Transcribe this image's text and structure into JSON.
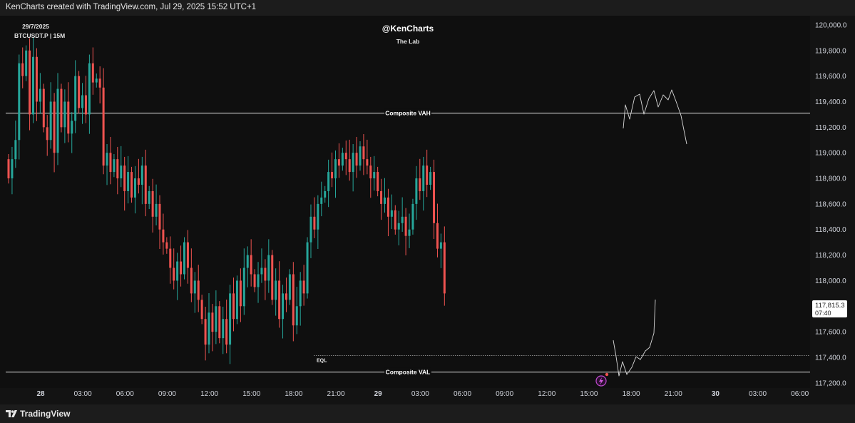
{
  "header": {
    "title": "KenCharts created with TradingView.com, Jul 29, 2025 15:52 UTC+1"
  },
  "footer": {
    "brand": "TradingView"
  },
  "chart_data": {
    "type": "candlestick",
    "symbol_date": "29/7/2025",
    "symbol": "BTCUSDT.P | 15M",
    "title": "@KenCharts",
    "subtitle": "The Lab",
    "y_ticks": [
      "120,000.0",
      "119,800.0",
      "119,600.0",
      "119,400.0",
      "119,200.0",
      "119,000.0",
      "118,800.0",
      "118,600.0",
      "118,400.0",
      "118,200.0",
      "118,000.0",
      "117,600.0",
      "117,400.0",
      "117,200.0"
    ],
    "y_range": [
      117200,
      120000
    ],
    "x_ticks": [
      "28",
      "03:00",
      "06:00",
      "09:00",
      "12:00",
      "15:00",
      "18:00",
      "21:00",
      "29",
      "03:00",
      "06:00",
      "09:00",
      "12:00",
      "15:00",
      "18:00",
      "21:00",
      "30",
      "03:00",
      "06:00"
    ],
    "price_label": {
      "price": "117,815.3",
      "countdown": "07:40"
    },
    "last_price": 117815.3,
    "levels": [
      {
        "name": "Composite VAH",
        "price": 119310
      },
      {
        "name": "Composite VAL",
        "price": 117285
      },
      {
        "name": "EQL",
        "price": 117415
      }
    ],
    "colors": {
      "up": "#26a69a",
      "down": "#ef5350",
      "line": "#ffffff",
      "background": "#0f0f0f"
    },
    "close_series": [
      118800,
      118950,
      119100,
      119700,
      119600,
      119800,
      119300,
      119750,
      119400,
      119500,
      119200,
      119100,
      119400,
      119000,
      119500,
      119200,
      119400,
      119150,
      119250,
      119600,
      119350,
      119450,
      119300,
      119700,
      119550,
      119580,
      119510,
      118900,
      119000,
      118850,
      118950,
      118800,
      118900,
      118700,
      118850,
      118650,
      118800,
      118750,
      118900,
      118600,
      118700,
      118500,
      118600,
      118400,
      118300,
      118250,
      118100,
      118000,
      118150,
      118050,
      118300,
      118100,
      117900,
      118000,
      117850,
      117700,
      117500,
      117750,
      117600,
      117800,
      117550,
      117700,
      117500,
      117900,
      117700,
      118000,
      117800,
      118100,
      118200,
      118050,
      117950,
      118050,
      118100,
      118000,
      118200,
      117850,
      118000,
      117700,
      117900,
      117850,
      118050,
      117650,
      117800,
      118000,
      117900,
      118300,
      118500,
      118400,
      118600,
      118650,
      118700,
      118850,
      118800,
      118950,
      118900,
      119000,
      118950,
      118850,
      119000,
      118900,
      119050,
      118950,
      118900,
      118800,
      118850,
      118700,
      118600,
      118650,
      118500,
      118550,
      118400,
      118450,
      118500,
      118350,
      118400,
      118600,
      118800,
      118700,
      118900,
      118750,
      118850,
      118450,
      118250,
      118300,
      117900
    ]
  }
}
